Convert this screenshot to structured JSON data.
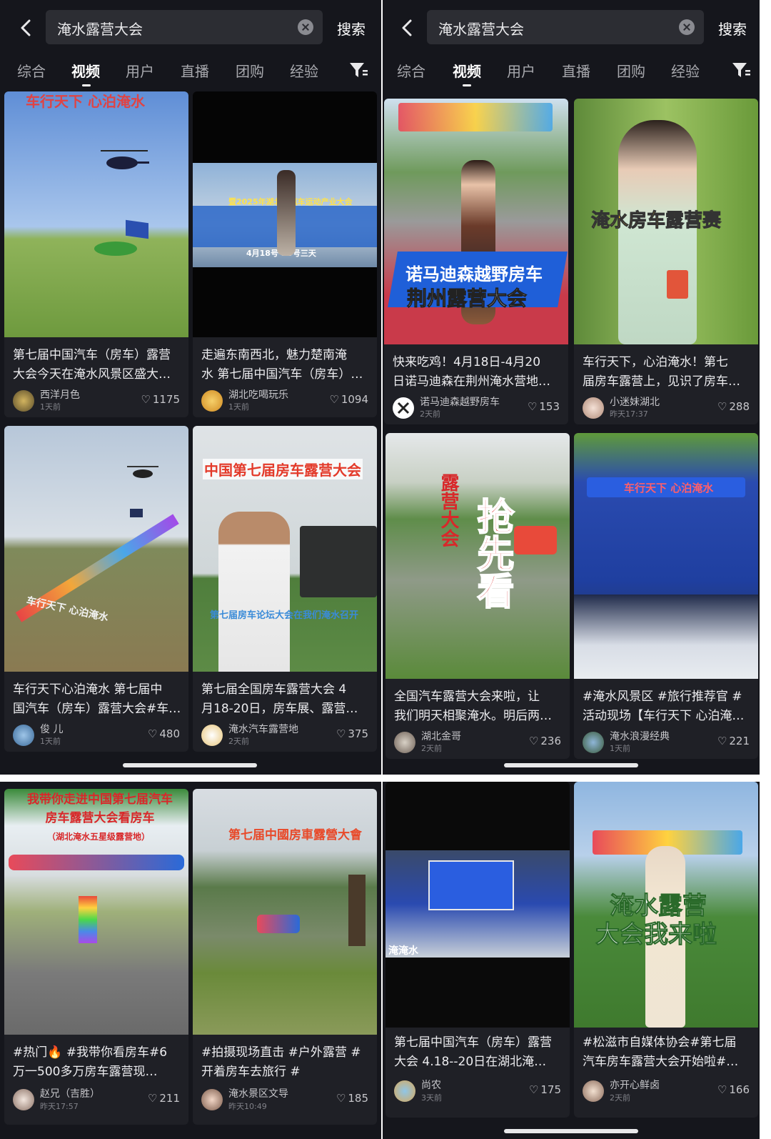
{
  "search": {
    "query": "淹水露营大会",
    "button": "搜索"
  },
  "tabs": [
    "综合",
    "视频",
    "用户",
    "直播",
    "团购",
    "经验"
  ],
  "colors": {
    "background": "#15161c",
    "card": "#1f2026",
    "search_box": "#2c2d33",
    "active_tab": "#ffffff"
  },
  "panels": {
    "top_left": [
      {
        "overlay": "车行天下 心泊淹水",
        "title_lines": [
          "第七届中国汽车（房车）露营",
          "大会今天在淹水风景区盛大…"
        ],
        "author": "西洋月色",
        "time": "1天前",
        "likes": "1175"
      },
      {
        "overlay": "暨2025年湖北省汽车运动产业大会",
        "overlay2": "4月18号-20号三天",
        "title_lines": [
          "走遍东南西北，魅力楚南淹",
          "水 第七届中国汽车（房车）…"
        ],
        "author": "湖北吃喝玩乐",
        "time": "1天前",
        "likes": "1094"
      },
      {
        "overlay": "车行天下 心泊淹水",
        "title_lines": [
          "车行天下心泊淹水 第七届中",
          "国汽车（房车）露营大会#车…"
        ],
        "author": "俊 儿",
        "time": "1天前",
        "likes": "480"
      },
      {
        "overlay": "中国第七届房车露营大会",
        "overlay2": "第七届房车论坛大会在我们淹水召开",
        "title_lines": [
          "第七届全国房车露营大会 4",
          "月18-20日，房车展、露营…"
        ],
        "author": "淹水汽车露营地",
        "time": "2天前",
        "likes": "375"
      }
    ],
    "top_right": [
      {
        "overlay": "诺马迪森越野房车",
        "overlay2": "荆州露营大会",
        "title_lines": [
          "快来吃鸡！4月18日-4月20",
          "日诺马迪森在荆州淹水营地…"
        ],
        "author": "诺马迪森越野房车",
        "time": "2天前",
        "likes": "153"
      },
      {
        "overlay": "淹水房车露营赛",
        "title_lines": [
          "车行天下，心泊淹水！第七",
          "届房车露营上，见识了房车…"
        ],
        "author": "小迷妹湖北",
        "time": "昨天17:37",
        "likes": "288"
      },
      {
        "overlay": "露营大会",
        "overlay2": "抢先看",
        "title_lines": [
          "全国汽车露营大会来啦，让",
          "我们明天相聚淹水。明后两…"
        ],
        "author": "湖北金哥",
        "time": "2天前",
        "likes": "236"
      },
      {
        "overlay": "车行天下 心泊淹水",
        "title_lines": [
          "#淹水风景区 #旅行推荐官 #",
          "活动现场【车行天下 心泊淹…"
        ],
        "author": "淹水浪漫经典",
        "time": "1天前",
        "likes": "221"
      }
    ],
    "bottom_left": [
      {
        "overlay": "我带你走进中国第七届汽车房车露营大会看房车",
        "overlay2": "（湖北淹水五星级露营地）",
        "title_lines": [
          "#热门🔥 #我带你看房车#6",
          "万一500多万房车露营现…"
        ],
        "author": "赵兄（吉胜）",
        "time": "昨天17:57",
        "likes": "211"
      },
      {
        "overlay": "第七届中國房車露營大會",
        "title_lines": [
          "#拍摄现场直击 #户外露营 #",
          "开着房车去旅行 #"
        ],
        "author": "淹水景区文导",
        "time": "昨天10:49",
        "likes": "185"
      }
    ],
    "bottom_right": [
      {
        "overlay": "淹淹水",
        "title_lines": [
          "第七届中国汽车（房车）露营",
          "大会 4.18--20日在湖北淹…"
        ],
        "author": "尚农",
        "time": "3天前",
        "likes": "175"
      },
      {
        "overlay": "淹水露营",
        "overlay2": "大会我来啦",
        "title_lines": [
          "#松滋市自媒体协会#第七届",
          "汽车房车露营大会开始啦#…"
        ],
        "author": "亦开心鲜卤",
        "time": "2天前",
        "likes": "166"
      }
    ]
  }
}
